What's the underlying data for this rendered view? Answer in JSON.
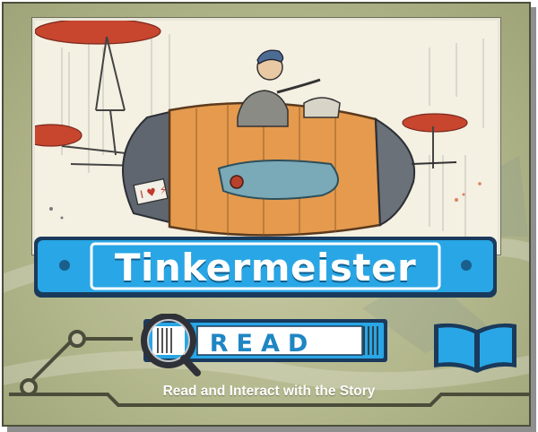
{
  "title": "Tinkermeister",
  "read_button": {
    "label": "READ"
  },
  "subtitle": "Read and Interact with the Story",
  "icons": {
    "magnifier": "magnifier-icon",
    "book": "open-book-icon"
  },
  "colors": {
    "banner_blue": "#29a6e5",
    "banner_dark": "#1a3a5c",
    "frame_olive": "#b3b78c",
    "button_text_blue": "#1f86c3"
  }
}
